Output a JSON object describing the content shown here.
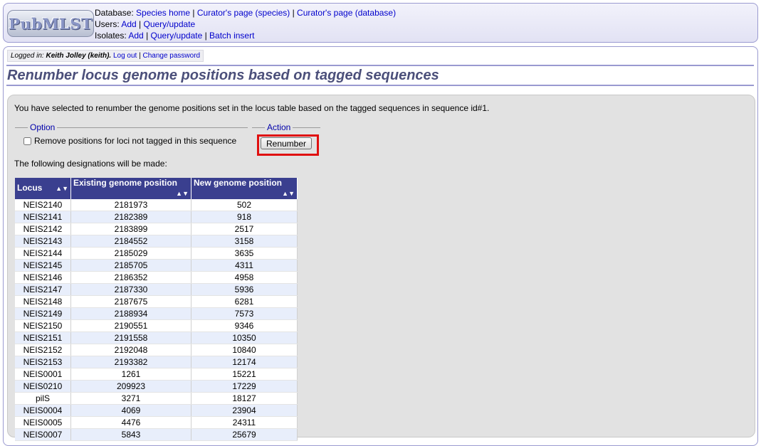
{
  "header": {
    "logo_text": "PubMLST",
    "database_label": "Database:",
    "database_links": [
      "Species home",
      "Curator's page (species)",
      "Curator's page (database)"
    ],
    "users_label": "Users:",
    "users_links": [
      "Add",
      "Query/update"
    ],
    "isolates_label": "Isolates:",
    "isolates_links": [
      "Add",
      "Query/update",
      "Batch insert"
    ],
    "separator": " | "
  },
  "login": {
    "prefix": "Logged in:",
    "user": "Keith Jolley (keith).",
    "logout": "Log out",
    "change_password": "Change password"
  },
  "page_title": "Renumber locus genome positions based on tagged sequences",
  "intro_text": "You have selected to renumber the genome positions set in the locus table based on the tagged sequences in sequence id#1.",
  "option": {
    "legend": "Option",
    "checkbox_label": "Remove positions for loci not tagged in this sequence",
    "checked": false
  },
  "action": {
    "legend": "Action",
    "button_label": "Renumber",
    "highlight_color": "#e01010"
  },
  "designations_text": "The following designations will be made:",
  "table": {
    "columns": [
      "Locus",
      "Existing genome position",
      "New genome position"
    ],
    "sort_icon": "sort-icon",
    "rows": [
      [
        "NEIS2140",
        "2181973",
        "502"
      ],
      [
        "NEIS2141",
        "2182389",
        "918"
      ],
      [
        "NEIS2142",
        "2183899",
        "2517"
      ],
      [
        "NEIS2143",
        "2184552",
        "3158"
      ],
      [
        "NEIS2144",
        "2185029",
        "3635"
      ],
      [
        "NEIS2145",
        "2185705",
        "4311"
      ],
      [
        "NEIS2146",
        "2186352",
        "4958"
      ],
      [
        "NEIS2147",
        "2187330",
        "5936"
      ],
      [
        "NEIS2148",
        "2187675",
        "6281"
      ],
      [
        "NEIS2149",
        "2188934",
        "7573"
      ],
      [
        "NEIS2150",
        "2190551",
        "9346"
      ],
      [
        "NEIS2151",
        "2191558",
        "10350"
      ],
      [
        "NEIS2152",
        "2192048",
        "10840"
      ],
      [
        "NEIS2153",
        "2193382",
        "12174"
      ],
      [
        "NEIS0001",
        "1261",
        "15221"
      ],
      [
        "NEIS0210",
        "209923",
        "17229"
      ],
      [
        "pilS",
        "3271",
        "18127"
      ],
      [
        "NEIS0004",
        "4069",
        "23904"
      ],
      [
        "NEIS0005",
        "4476",
        "24311"
      ],
      [
        "NEIS0007",
        "5843",
        "25679"
      ]
    ]
  },
  "colors": {
    "header_bg": "#e2e2f4",
    "table_header_bg": "#3a3f8f",
    "title_color": "#4b4f7a",
    "link_color": "#0000cc",
    "row_alt_bg": "#e8eefb",
    "content_bg": "#e2e2e2"
  }
}
